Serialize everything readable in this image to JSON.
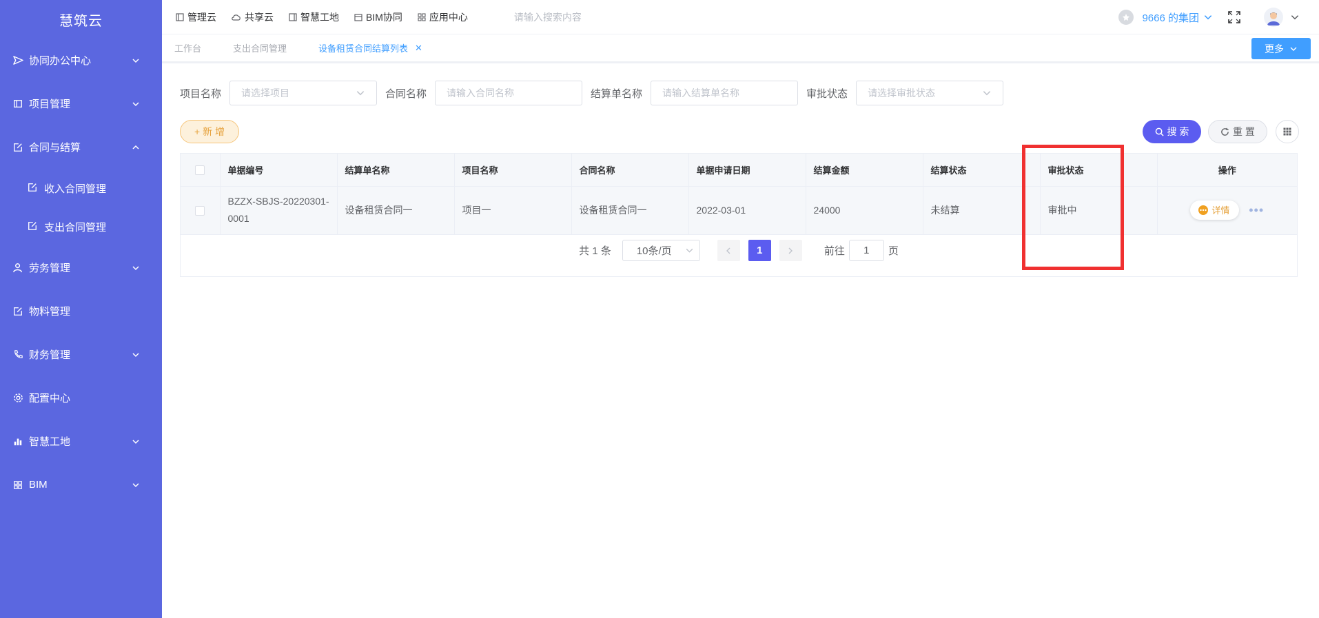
{
  "app": {
    "brand": "慧筑云"
  },
  "sidebar": {
    "items": [
      {
        "label": "协同办公中心",
        "icon": "send-icon",
        "expandable": true,
        "expanded": false
      },
      {
        "label": "项目管理",
        "icon": "book-icon",
        "expandable": true,
        "expanded": false
      },
      {
        "label": "合同与结算",
        "icon": "edit-icon",
        "expandable": true,
        "expanded": true
      },
      {
        "label": "劳务管理",
        "icon": "worker-icon",
        "expandable": true,
        "expanded": false
      },
      {
        "label": "物料管理",
        "icon": "edit-icon",
        "expandable": false
      },
      {
        "label": "财务管理",
        "icon": "phone-icon",
        "expandable": true,
        "expanded": false
      },
      {
        "label": "配置中心",
        "icon": "gear-icon",
        "expandable": false
      },
      {
        "label": "智慧工地",
        "icon": "bar-chart-icon",
        "expandable": true,
        "expanded": false
      },
      {
        "label": "BIM",
        "icon": "grid-icon",
        "expandable": true,
        "expanded": false
      }
    ],
    "subitems": [
      {
        "label": "收入合同管理",
        "icon": "edit-icon"
      },
      {
        "label": "支出合同管理",
        "icon": "edit-icon"
      }
    ]
  },
  "topbar": {
    "nav": [
      {
        "label": "管理云",
        "icon": "panel-icon"
      },
      {
        "label": "共享云",
        "icon": "cloud-icon"
      },
      {
        "label": "智慧工地",
        "icon": "book-icon"
      },
      {
        "label": "BIM协同",
        "icon": "box-icon"
      },
      {
        "label": "应用中心",
        "icon": "apps-icon"
      }
    ],
    "search_placeholder": "请输入搜索内容",
    "group_name": "9666 的集团"
  },
  "tabs": [
    {
      "label": "工作台",
      "active": false
    },
    {
      "label": "支出合同管理",
      "active": false
    },
    {
      "label": "设备租赁合同结算列表",
      "active": true,
      "closable": true
    }
  ],
  "more_label": "更多",
  "filters": {
    "project": {
      "label": "项目名称",
      "placeholder": "请选择项目"
    },
    "contract": {
      "label": "合同名称",
      "placeholder": "请输入合同名称"
    },
    "settlement": {
      "label": "结算单名称",
      "placeholder": "请输入结算单名称"
    },
    "approval": {
      "label": "审批状态",
      "placeholder": "请选择审批状态"
    }
  },
  "actions": {
    "add": "+ 新 增",
    "search": "搜 索",
    "reset": "重 置"
  },
  "table": {
    "columns": [
      "单据编号",
      "结算单名称",
      "项目名称",
      "合同名称",
      "单据申请日期",
      "结算金额",
      "结算状态",
      "审批状态",
      "操作"
    ],
    "rows": [
      {
        "code_line1": "BZZX-SBJS-20220301-",
        "code_line2": "0001",
        "settlement_name": "设备租赁合同一",
        "project": "项目一",
        "contract": "设备租赁合同一",
        "date": "2022-03-01",
        "amount": "24000",
        "settle_status": "未结算",
        "approval_status": "审批中",
        "detail_label": "详情"
      }
    ]
  },
  "pagination": {
    "total": "共 1 条",
    "page_size": "10条/页",
    "current": "1",
    "goto_prefix": "前往",
    "goto_value": "1",
    "goto_suffix": "页"
  },
  "colors": {
    "sidebar": "#5b67e0",
    "primary": "#5b5cf0",
    "link": "#409eff",
    "highlight": "#f03030",
    "warning": "#e6a23c"
  }
}
